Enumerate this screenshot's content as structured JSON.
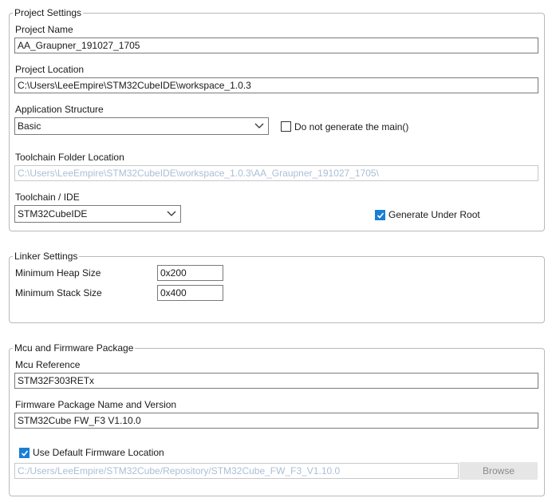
{
  "project_settings": {
    "legend": "Project Settings",
    "project_name_label": "Project Name",
    "project_name_value": "AA_Graupner_191027_1705",
    "project_location_label": "Project Location",
    "project_location_value": "C:\\Users\\LeeEmpire\\STM32CubeIDE\\workspace_1.0.3",
    "app_structure_label": "Application Structure",
    "app_structure_value": "Basic",
    "no_main_label": "Do not generate the main()",
    "no_main_checked": false,
    "toolchain_folder_label": "Toolchain Folder Location",
    "toolchain_folder_value": "C:\\Users\\LeeEmpire\\STM32CubeIDE\\workspace_1.0.3\\AA_Graupner_191027_1705\\",
    "toolchain_ide_label": "Toolchain / IDE",
    "toolchain_ide_value": "STM32CubeIDE",
    "generate_under_root_label": "Generate Under Root",
    "generate_under_root_checked": true
  },
  "linker_settings": {
    "legend": "Linker Settings",
    "min_heap_label": "Minimum Heap Size",
    "min_heap_value": "0x200",
    "min_stack_label": "Minimum Stack Size",
    "min_stack_value": "0x400"
  },
  "mcu_firmware": {
    "legend": "Mcu and Firmware Package",
    "mcu_ref_label": "Mcu Reference",
    "mcu_ref_value": "STM32F303RETx",
    "fw_pkg_label": "Firmware Package Name and Version",
    "fw_pkg_value": "STM32Cube FW_F3 V1.10.0",
    "use_default_label": "Use Default Firmware Location",
    "use_default_checked": true,
    "fw_location_value": "C:/Users/LeeEmpire/STM32Cube/Repository/STM32Cube_FW_F3_V1.10.0",
    "browse_label": "Browse"
  },
  "colors": {
    "accent": "#1a7fd4",
    "disabled_text": "#a9bfd6",
    "border": "#b9b9b9"
  },
  "icons": {
    "dropdown": "chevron-down-icon",
    "check": "checkmark-icon"
  }
}
